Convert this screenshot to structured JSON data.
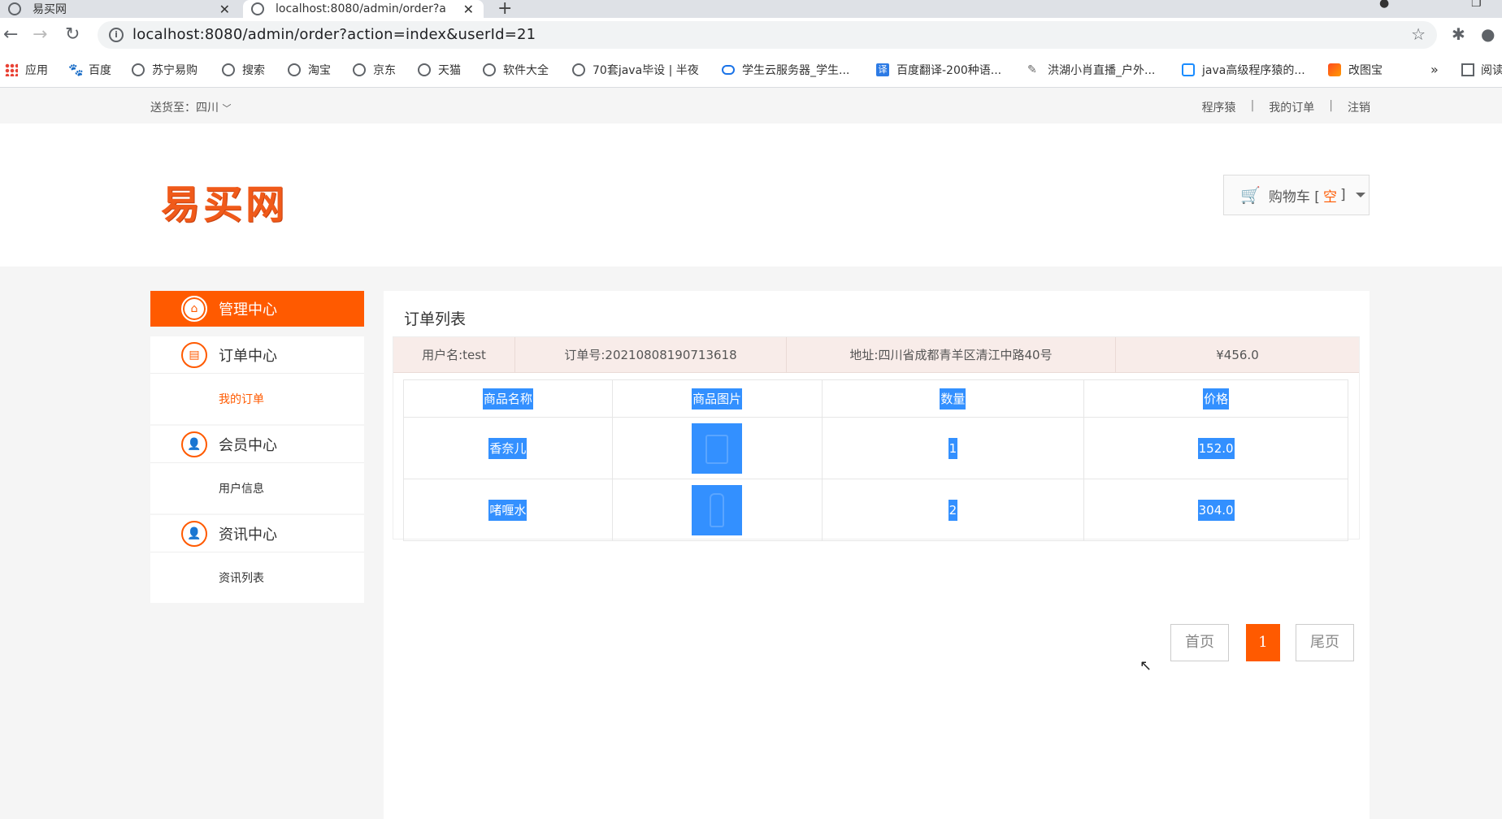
{
  "browser": {
    "tabs": [
      {
        "title": "易买网"
      },
      {
        "title": "localhost:8080/admin/order?a"
      }
    ],
    "url": "localhost:8080/admin/order?action=index&userId=21",
    "bookmarks": [
      {
        "label": "应用",
        "icon": "apps-icon"
      },
      {
        "label": "百度",
        "icon": "baidu-icon"
      },
      {
        "label": "苏宁易购",
        "icon": "globe-icon"
      },
      {
        "label": "搜索",
        "icon": "globe-icon"
      },
      {
        "label": "淘宝",
        "icon": "globe-icon"
      },
      {
        "label": "京东",
        "icon": "globe-icon"
      },
      {
        "label": "天猫",
        "icon": "globe-icon"
      },
      {
        "label": "软件大全",
        "icon": "globe-icon"
      },
      {
        "label": "70套java毕设 | 半夜",
        "icon": "globe-icon"
      },
      {
        "label": "学生云服务器_学生...",
        "icon": "cloud-icon"
      },
      {
        "label": "百度翻译-200种语...",
        "icon": "translate-icon"
      },
      {
        "label": "洪湖小肖直播_户外...",
        "icon": "feather-icon"
      },
      {
        "label": "java高级程序猿的...",
        "icon": "tv-icon"
      },
      {
        "label": "改图宝",
        "icon": "gaitubao-icon"
      }
    ],
    "more": "»",
    "reading_list": "阅读"
  },
  "topbar": {
    "deliver_to": "送货至：四川",
    "links": [
      "程序猿",
      "我的订单",
      "注销"
    ]
  },
  "header": {
    "logo": "易买网",
    "cart_label": "购物车 [",
    "cart_status": "空",
    "cart_close": "]"
  },
  "sidebar": {
    "active": {
      "label": "管理中心"
    },
    "sections": [
      {
        "title": "订单中心",
        "items": [
          "我的订单"
        ]
      },
      {
        "title": "会员中心",
        "items": [
          "用户信息"
        ]
      },
      {
        "title": "资讯中心",
        "items": [
          "资讯列表"
        ]
      }
    ]
  },
  "content": {
    "title": "订单列表",
    "order": {
      "username": "用户名:test",
      "order_no": "订单号:20210808190713618",
      "address": "地址:四川省成都青羊区清江中路40号",
      "total": "¥456.0"
    },
    "columns": [
      "商品名称",
      "商品图片",
      "数量",
      "价格"
    ],
    "rows": [
      {
        "name": "香奈儿",
        "qty": "1",
        "price": "152.0"
      },
      {
        "name": "啫喱水",
        "qty": "2",
        "price": "304.0"
      }
    ],
    "pager": {
      "first": "首页",
      "current": "1",
      "last": "尾页"
    }
  },
  "colors": {
    "accent": "#ff5a00",
    "selection": "#3390ff"
  }
}
